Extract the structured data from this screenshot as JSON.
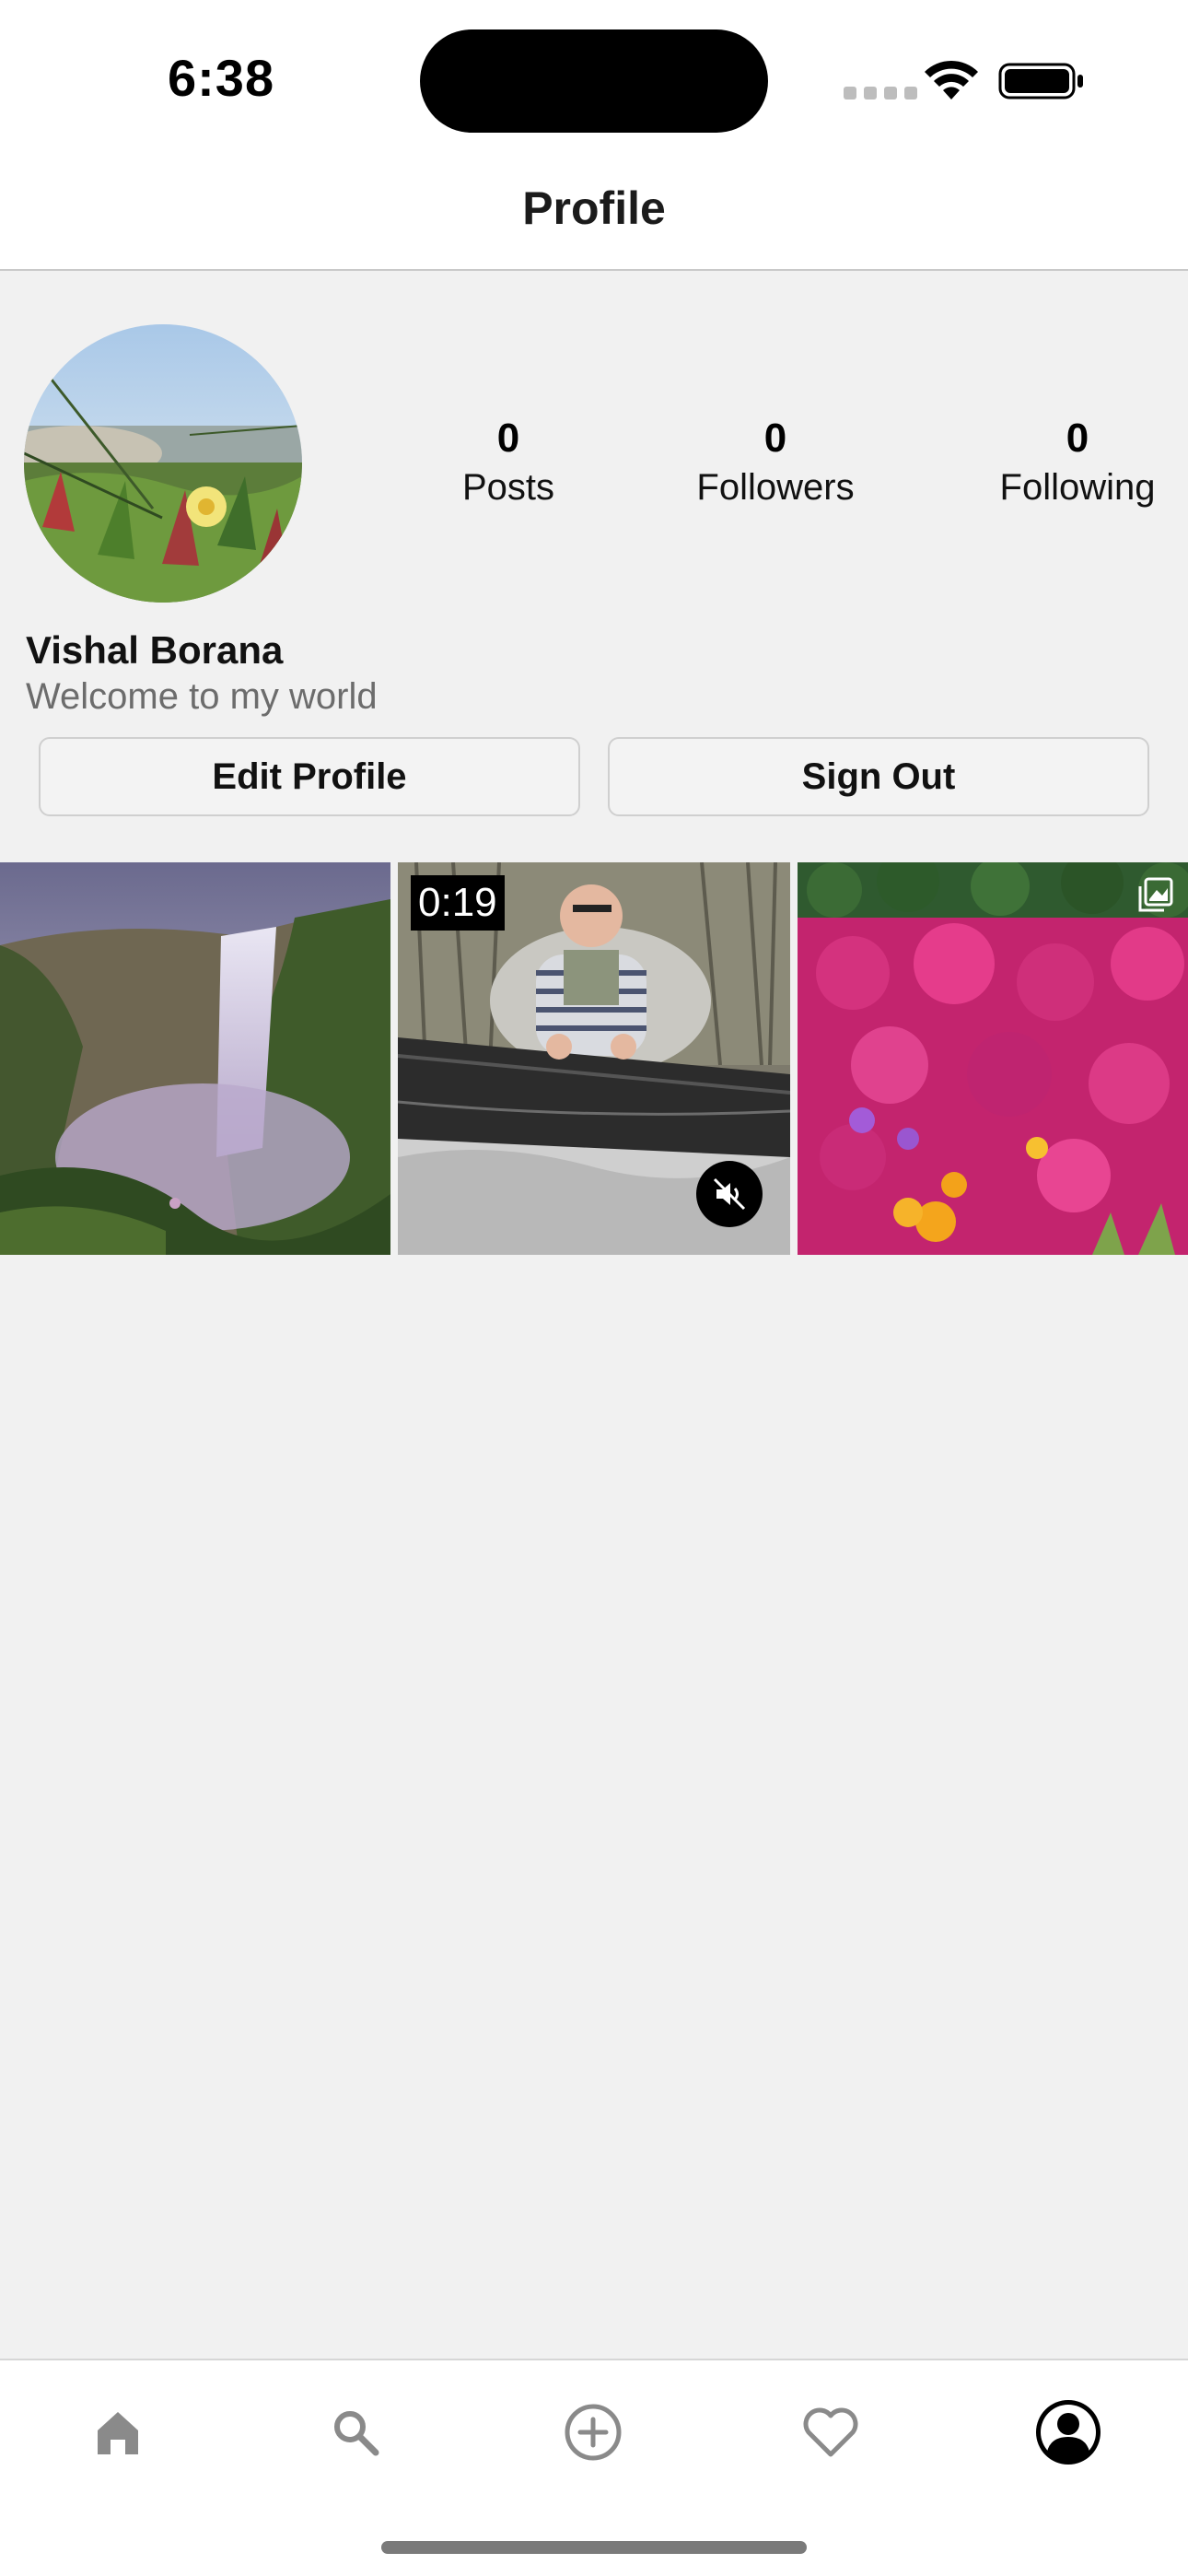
{
  "status_bar": {
    "time": "6:38",
    "icons": [
      "signal-icon",
      "wifi-icon",
      "battery-icon"
    ]
  },
  "header": {
    "title": "Profile"
  },
  "profile": {
    "avatar": "avatar-image",
    "name": "Vishal Borana",
    "bio": "Welcome to my world",
    "stats": {
      "posts_count": "0",
      "posts_label": "Posts",
      "followers_count": "0",
      "followers_label": "Followers",
      "following_count": "0",
      "following_label": "Following"
    },
    "buttons": {
      "edit_label": "Edit Profile",
      "signout_label": "Sign Out"
    }
  },
  "posts": [
    {
      "kind": "image",
      "subject": "waterfall"
    },
    {
      "kind": "video",
      "duration": "0:19",
      "muted": true,
      "subject": "man-with-net"
    },
    {
      "kind": "carousel",
      "subject": "pink-flowers"
    }
  ],
  "tab_bar": {
    "items": [
      "home-icon",
      "search-icon",
      "add-post-icon",
      "heart-icon",
      "profile-icon"
    ],
    "active": "profile-icon"
  },
  "colors": {
    "background": "#f1f1f1",
    "surface": "#ffffff",
    "muted_text": "#6c6c6c",
    "tab_icon": "#8a8a8a"
  }
}
